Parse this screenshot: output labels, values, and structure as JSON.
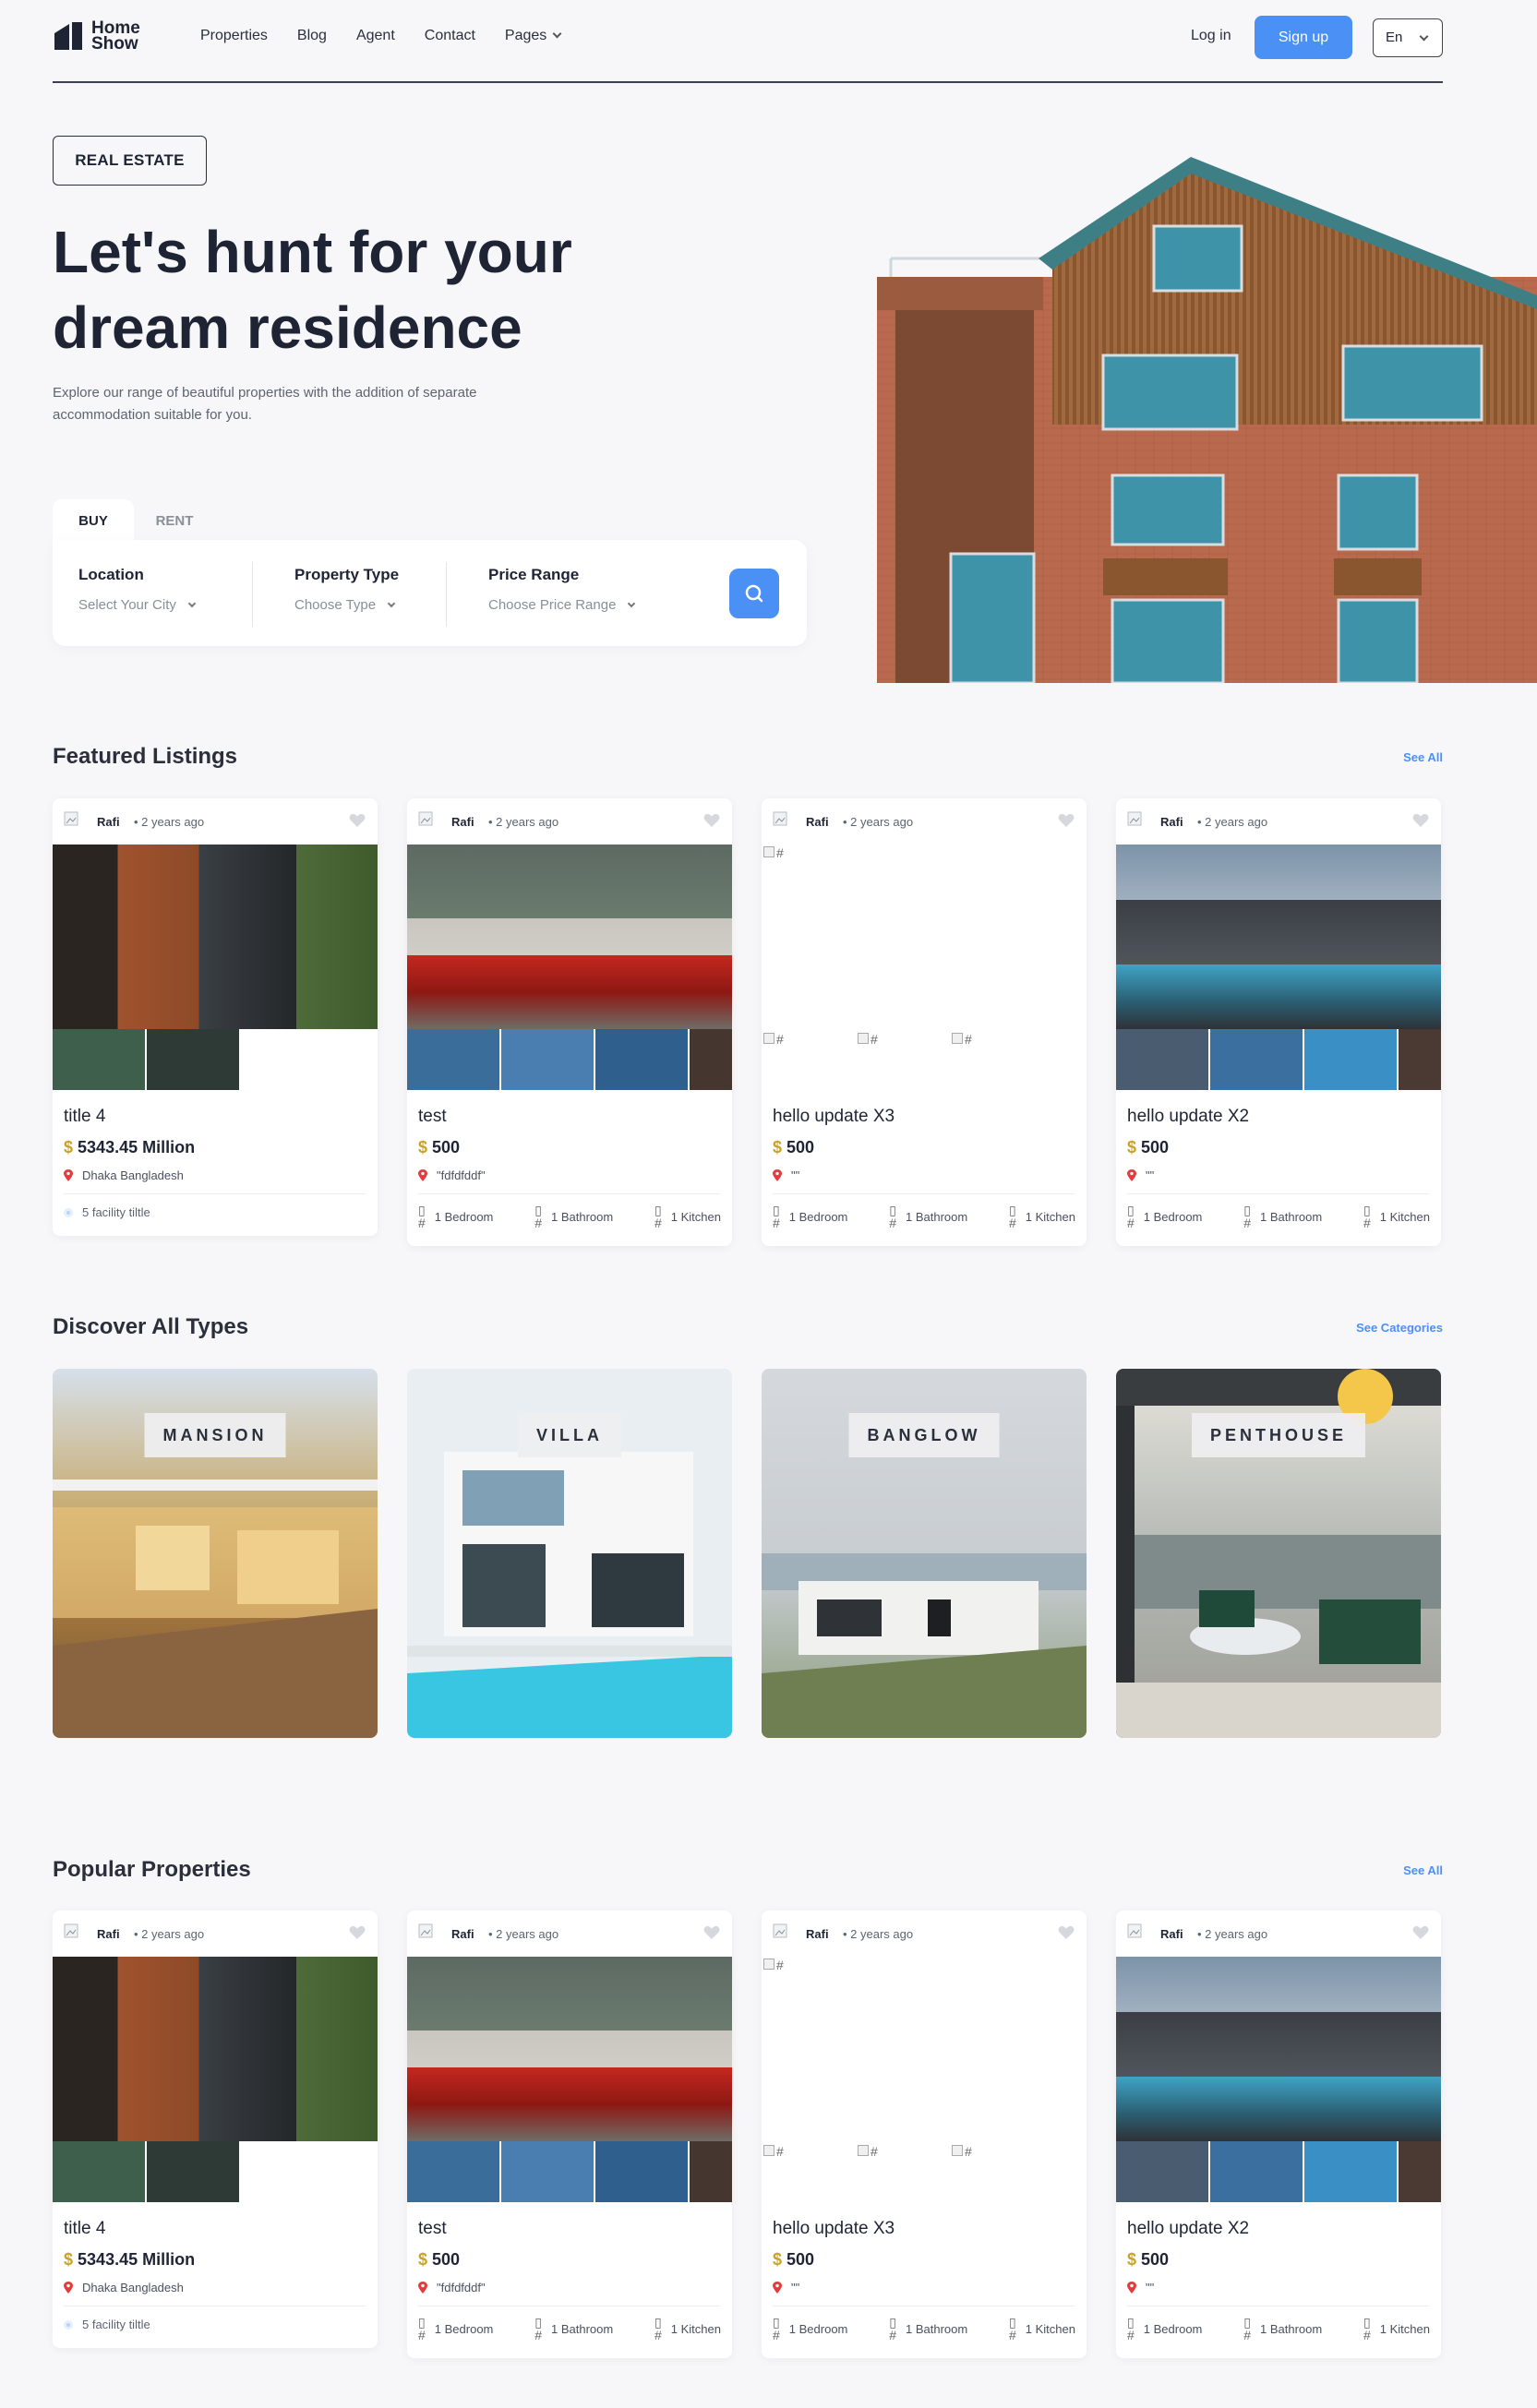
{
  "header": {
    "logo_line1": "Home",
    "logo_line2": "Show",
    "menu": [
      "Properties",
      "Blog",
      "Agent",
      "Contact",
      "Pages"
    ],
    "login": "Log in",
    "signup": "Sign up",
    "language": "En"
  },
  "hero": {
    "badge": "REAL ESTATE",
    "title_line1": "Let's hunt for your",
    "title_line2": "dream residence",
    "subtitle_line1": "Explore our range of beautiful properties with the addition of separate",
    "subtitle_line2": "accommodation suitable for you.",
    "tabs": [
      "BUY",
      "RENT"
    ],
    "fields": [
      {
        "label": "Location",
        "value": "Select Your City"
      },
      {
        "label": "Property Type",
        "value": "Choose Type"
      },
      {
        "label": "Price Range",
        "value": "Choose Price Range"
      }
    ]
  },
  "featured": {
    "title": "Featured Listings",
    "see_all": "See All",
    "cards": [
      {
        "author": "Rafi",
        "ago": "• 2 years ago",
        "title": "title 4",
        "price": "5343.45 Million",
        "location": "Dhaka Bangladesh",
        "facility": "5 facility tiltle"
      },
      {
        "author": "Rafi",
        "ago": "• 2 years ago",
        "title": "test",
        "price": "500",
        "location": "\"fdfdfddf\"",
        "bedroom": "1 Bedroom",
        "bathroom": "1 Bathroom",
        "kitchen": "1 Kitchen"
      },
      {
        "author": "Rafi",
        "ago": "• 2 years ago",
        "title": "hello update X3",
        "price": "500",
        "location": "\"\"",
        "bedroom": "1 Bedroom",
        "bathroom": "1 Bathroom",
        "kitchen": "1 Kitchen",
        "broken_alt": "#"
      },
      {
        "author": "Rafi",
        "ago": "• 2 years ago",
        "title": "hello update X2",
        "price": "500",
        "location": "\"\"",
        "bedroom": "1 Bedroom",
        "bathroom": "1 Bathroom",
        "kitchen": "1 Kitchen"
      }
    ]
  },
  "types": {
    "title": "Discover All Types",
    "see_all": "See Categories",
    "items": [
      "MANSION",
      "VILLA",
      "BANGLOW",
      "PENTHOUSE"
    ]
  },
  "popular": {
    "title": "Popular Properties",
    "see_all": "See All",
    "cards": [
      {
        "author": "Rafi",
        "ago": "• 2 years ago",
        "title": "title 4",
        "price": "5343.45 Million",
        "location": "Dhaka Bangladesh",
        "facility": "5 facility tiltle"
      },
      {
        "author": "Rafi",
        "ago": "• 2 years ago",
        "title": "test",
        "price": "500",
        "location": "\"fdfdfddf\"",
        "bedroom": "1 Bedroom",
        "bathroom": "1 Bathroom",
        "kitchen": "1 Kitchen"
      },
      {
        "author": "Rafi",
        "ago": "• 2 years ago",
        "title": "hello update X3",
        "price": "500",
        "location": "\"\"",
        "bedroom": "1 Bedroom",
        "bathroom": "1 Bathroom",
        "kitchen": "1 Kitchen",
        "broken_alt": "#"
      },
      {
        "author": "Rafi",
        "ago": "• 2 years ago",
        "title": "hello update X2",
        "price": "500",
        "location": "\"\"",
        "bedroom": "1 Bedroom",
        "bathroom": "1 Bathroom",
        "kitchen": "1 Kitchen"
      }
    ]
  },
  "colors": {
    "accent": "#4a90f5",
    "text": "#1f2435",
    "price_symbol": "#c9a227",
    "pin": "#e23b3b"
  },
  "currency_symbol": "$"
}
